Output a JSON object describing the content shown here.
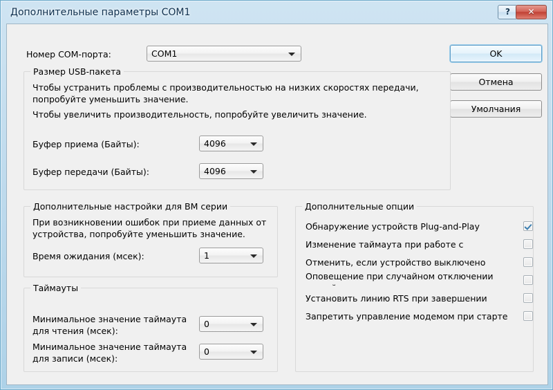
{
  "window": {
    "title": "Дополнительные параметры COM1",
    "help_button": "?",
    "close_button": "✕"
  },
  "com_port": {
    "label": "Номер COM-порта:",
    "value": "COM1"
  },
  "buttons": {
    "ok": "OK",
    "cancel": "Отмена",
    "defaults": "Умолчания"
  },
  "usb_packet": {
    "title": "Размер USB-пакета",
    "desc_line1": "Чтобы устранить проблемы с производительностью на низких скоростях передачи,",
    "desc_line2": "попробуйте уменьшить значение.",
    "desc_line3": "Чтобы увеличить производительность, попробуйте увеличить значение.",
    "rx_label": "Буфер приема (Байты):",
    "rx_value": "4096",
    "tx_label": "Буфер передачи (Байты):",
    "tx_value": "4096"
  },
  "bm_series": {
    "title": "Дополнительные настройки для BM серии",
    "desc_line1": "При возникновении ошибок при приеме данных от",
    "desc_line2": "устройства, попробуйте уменьшить значение.",
    "latency_label": "Время ожидания (мсек):",
    "latency_value": "1"
  },
  "timeouts": {
    "title": "Таймауты",
    "read_label_line1": "Минимальное значение таймаута",
    "read_label_line2": "для чтения (мсек):",
    "read_value": "0",
    "write_label_line1": "Минимальное значение таймаута",
    "write_label_line2": "для записи (мсек):",
    "write_value": "0"
  },
  "options": {
    "title": "Дополнительные опции",
    "items": [
      {
        "label": "Обнаружение устройств Plug-and-Play",
        "checked": true
      },
      {
        "label": "Изменение таймаута при работе с принтером",
        "checked": false
      },
      {
        "label": "Отменить, если устройство выключено",
        "checked": false
      },
      {
        "label": "Оповещение при случайном отключении устройства",
        "checked": false
      },
      {
        "label": "Установить линию RTS при завершении работы",
        "checked": false
      },
      {
        "label": "Запретить управление модемом при старте",
        "checked": false
      }
    ]
  },
  "colors": {
    "frame": "#aed2e8",
    "client": "#f0f0f0",
    "accent": "#3c7fb1",
    "close": "#c04134"
  }
}
